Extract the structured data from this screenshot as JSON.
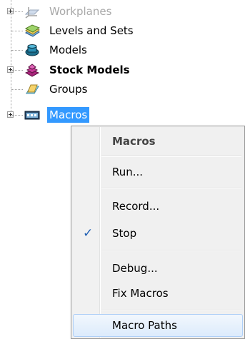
{
  "tree": {
    "items": [
      {
        "label": "Workplanes",
        "icon": "workplane-icon",
        "expander": true,
        "style": "faded"
      },
      {
        "label": "Levels and Sets",
        "icon": "levels-icon",
        "expander": false,
        "style": "normal"
      },
      {
        "label": "Models",
        "icon": "model-icon",
        "expander": false,
        "style": "normal"
      },
      {
        "label": "Stock Models",
        "icon": "stock-model-icon",
        "expander": true,
        "style": "bold"
      },
      {
        "label": "Groups",
        "icon": "group-icon",
        "expander": false,
        "style": "normal"
      },
      {
        "label": "Macros",
        "icon": "macro-icon",
        "expander": true,
        "style": "selected"
      }
    ]
  },
  "context_menu": {
    "header": "Macros",
    "items": {
      "run": "Run...",
      "record": "Record...",
      "stop": "Stop",
      "debug": "Debug...",
      "fix_macros": "Fix Macros",
      "macro_paths": "Macro Paths"
    },
    "checked_item": "stop",
    "hovered_item": "macro_paths"
  },
  "colors": {
    "selection": "#3399ff",
    "check": "#1f5fb3",
    "menu_background": "#f0f0f0"
  }
}
